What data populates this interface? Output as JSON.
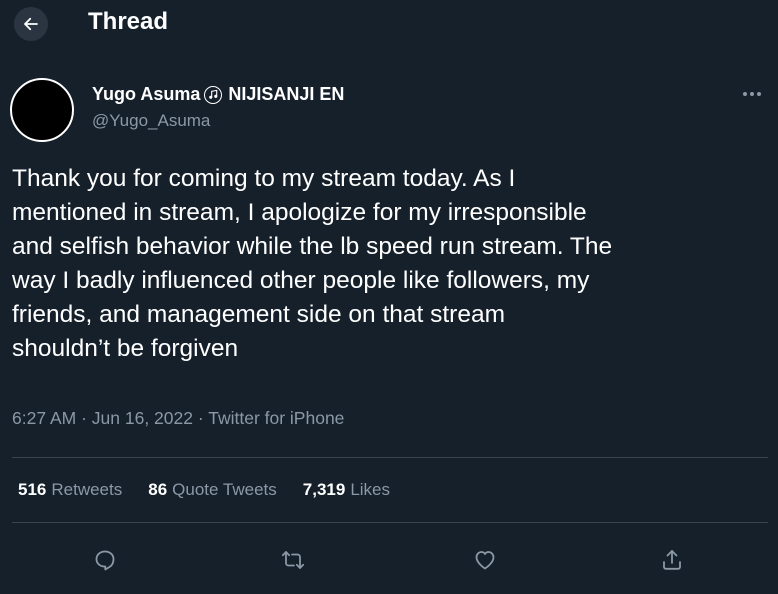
{
  "header": {
    "title": "Thread",
    "back_icon": "arrow-left-icon"
  },
  "author": {
    "name": "Yugo Asuma",
    "affiliation": "NIJISANJI EN",
    "affiliation_badge_icon": "music-note-badge-icon",
    "handle": "@Yugo_Asuma",
    "more_icon": "more-horizontal-icon"
  },
  "tweet": {
    "text": "Thank you for coming to my stream today. As I\nmentioned in stream, I apologize for my irresponsible\nand selfish behavior while the lb speed run stream. The\nway I badly influenced other people like followers, my\nfriends, and management side on that stream\nshouldn’t be forgiven",
    "time": "6:27 AM",
    "separator": " · ",
    "date": "Jun 16, 2022",
    "source": "Twitter for iPhone"
  },
  "stats": {
    "retweets_count": "516",
    "retweets_label": "Retweets",
    "quotes_count": "86",
    "quotes_label": "Quote Tweets",
    "likes_count": "7,319",
    "likes_label": "Likes"
  },
  "actions": {
    "reply_icon": "reply-icon",
    "retweet_icon": "retweet-icon",
    "like_icon": "heart-icon",
    "share_icon": "share-icon"
  },
  "colors": {
    "background": "#15202b",
    "text_primary": "#ffffff",
    "text_secondary": "#8b98a5",
    "divider": "#38444d"
  }
}
